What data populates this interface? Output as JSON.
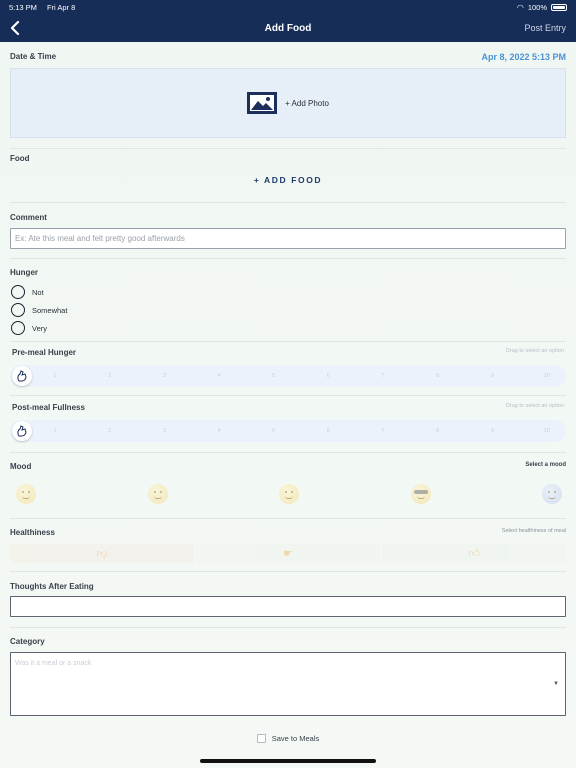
{
  "status_bar": {
    "time": "5:13 PM",
    "date": "Fri Apr 8",
    "battery": "100%"
  },
  "nav": {
    "title": "Add Food",
    "post_label": "Post Entry"
  },
  "date_time": {
    "label": "Date & Time",
    "value": "Apr 8, 2022 5:13 PM"
  },
  "photo": {
    "label": "+ Add Photo",
    "icon": "image-icon"
  },
  "food": {
    "label": "Food",
    "add_label": "+ ADD FOOD"
  },
  "comment": {
    "label": "Comment",
    "placeholder": "Ex: Ate this meal and felt pretty good afterwards"
  },
  "hunger": {
    "label": "Hunger",
    "options": [
      "Not",
      "Somewhat",
      "Very"
    ]
  },
  "pre_meal": {
    "label": "Pre-meal Hunger",
    "hint": "Drag to select an option",
    "ticks": [
      "1",
      "2",
      "3",
      "4",
      "5",
      "6",
      "7",
      "8",
      "9",
      "10"
    ]
  },
  "post_meal": {
    "label": "Post-meal Fullness",
    "hint": "Drag to select an option",
    "ticks": [
      "1",
      "2",
      "3",
      "4",
      "5",
      "6",
      "7",
      "8",
      "9",
      "10"
    ]
  },
  "mood": {
    "label": "Mood",
    "hint": "Select a mood",
    "options": [
      "smile-icon",
      "relieved-icon",
      "dizzy-icon",
      "sunglasses-icon",
      "fearful-icon"
    ]
  },
  "healthiness": {
    "label": "Healthiness",
    "hint": "Select healthiness of meal",
    "options": [
      "thumbs-down-icon",
      "thumbs-sideways-icon",
      "thumbs-up-icon"
    ]
  },
  "thoughts": {
    "label": "Thoughts After Eating"
  },
  "category": {
    "label": "Category",
    "placeholder": "Was it a meal or a snack"
  },
  "save": {
    "label": "Save to Meals"
  },
  "colors": {
    "nav_bg": "#162d57",
    "accent": "#4a93d6"
  }
}
